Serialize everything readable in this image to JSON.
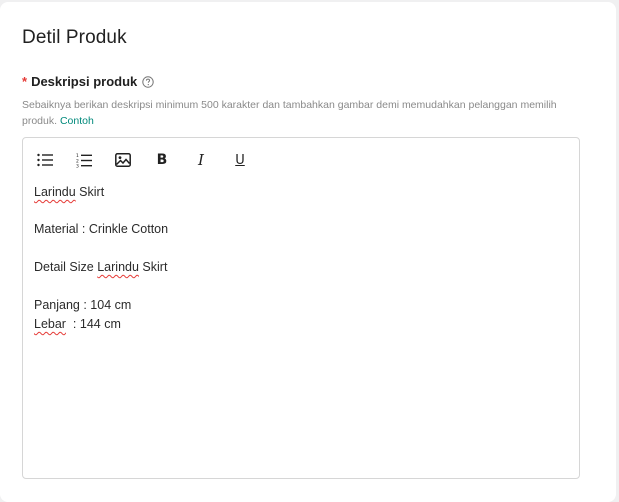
{
  "section": {
    "title": "Detil Produk"
  },
  "field": {
    "required_mark": "*",
    "label": "Deskripsi produk",
    "help_text": "Sebaiknya berikan deskripsi minimum 500 karakter dan tambahkan gambar demi memudahkan pelanggan memilih produk.",
    "help_link": "Contoh"
  },
  "toolbar": {
    "bullet_list_icon": "bullet-list-icon",
    "numbered_list_icon": "numbered-list-icon",
    "image_icon": "image-icon",
    "bold_label": "B",
    "italic_label": "I",
    "underline_label": "U"
  },
  "content": {
    "line1_word": "Larindu",
    "line1_rest": " Skirt",
    "line2": "Material : Crinkle Cotton",
    "line3_prefix": "Detail Size ",
    "line3_word": "Larindu",
    "line3_rest": " Skirt",
    "line4": "Panjang : 104 cm",
    "line5_word": "Lebar",
    "line5_rest": "  : 144 cm"
  }
}
